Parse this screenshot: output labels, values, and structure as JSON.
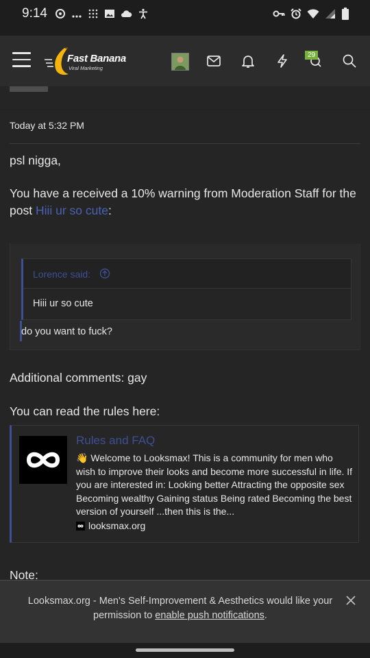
{
  "status_bar": {
    "time": "9:14",
    "left_icons": [
      "sync-icon",
      "more-dots-icon",
      "grid-dots-icon",
      "image-icon",
      "cloud-icon",
      "accessibility-icon"
    ],
    "right_icons": [
      "vpn-key-icon",
      "alarm-icon",
      "wifi-icon",
      "cell-signal-icon",
      "battery-icon"
    ]
  },
  "header": {
    "logo_title": "Fast Banana",
    "logo_subtitle": "Viral Marketing",
    "conversations_badge": "29",
    "icons": [
      "menu-icon",
      "avatar",
      "inbox-icon",
      "alerts-bell-icon",
      "whats-new-bolt-icon",
      "conversations-icon",
      "search-icon"
    ]
  },
  "post": {
    "timestamp": "Today at 5:32 PM",
    "greeting": "psl nigga,",
    "warning_text": "You have a received a 10% warning from Moderation Staff for the post ",
    "warning_link": "Hiii ur so cute",
    "warning_suffix": ":",
    "quote": {
      "author": "Lorence said:",
      "inner_text": "Hiii ur so cute",
      "reply_text": "do you want to fuck?"
    },
    "additional_comments": "Additional comments: gay",
    "rules_intro": "You can read the rules here:",
    "link_preview": {
      "title": "Rules and FAQ",
      "emoji": "👋",
      "description": "Welcome to Looksmax! This is a community for men who wish to improve their looks and become more successful in life. If you are interested in: Looking better Attracting the opposite sex Becoming wealthy Gaining status Being rated Becoming the best version of yourself ...then this is the...",
      "site": "looksmax.org"
    },
    "note_label": "Note:"
  },
  "push_banner": {
    "text_before": "Looksmax.org - Men's Self-Improvement & Aesthetics would like your permission to ",
    "link_text": "enable push notifications",
    "text_after": "."
  },
  "colors": {
    "background": "#252525",
    "header": "#2c2c2c",
    "link_blue": "#4a62b6",
    "quote_accent": "#3e4f94",
    "badge_green": "#78b13e"
  }
}
